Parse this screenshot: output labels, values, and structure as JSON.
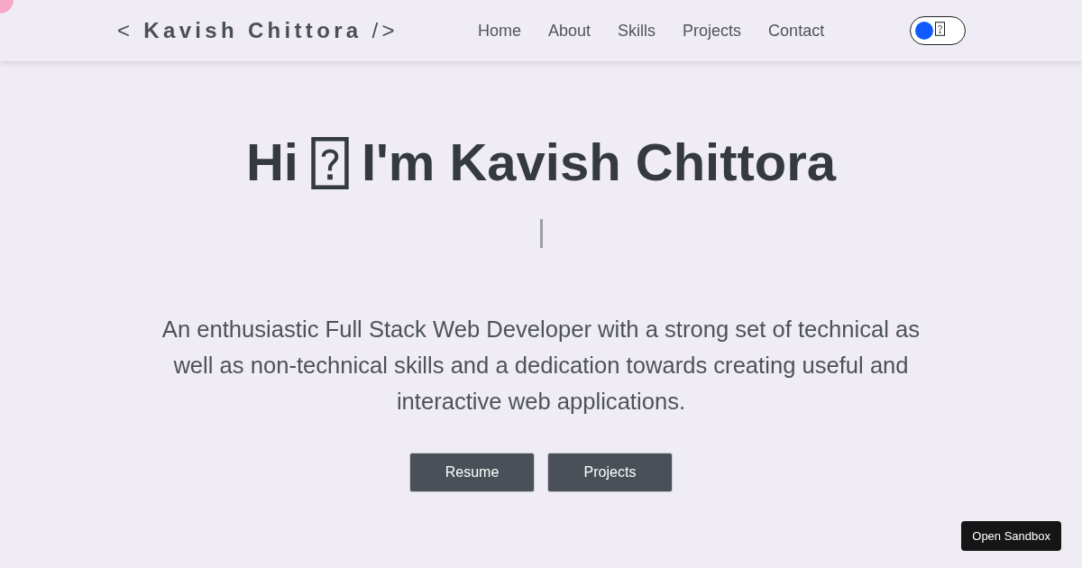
{
  "navbar": {
    "logo": "< **Kavish Chittora** />",
    "links": [
      {
        "label": "Home"
      },
      {
        "label": "About"
      },
      {
        "label": "Skills"
      },
      {
        "label": "Projects"
      },
      {
        "label": "Contact"
      }
    ],
    "theme_toggle": {
      "on": false
    }
  },
  "hero": {
    "greeting": "Hi",
    "name": "I'm Kavish Chittora",
    "description": "An enthusiastic Full Stack Web Developer with a strong set of technical as well as non-technical skills and a dedication towards creating useful and interactive web applications.",
    "buttons": [
      {
        "label": "Resume"
      },
      {
        "label": "Projects"
      }
    ]
  },
  "sandbox_button": {
    "label": "Open Sandbox"
  }
}
